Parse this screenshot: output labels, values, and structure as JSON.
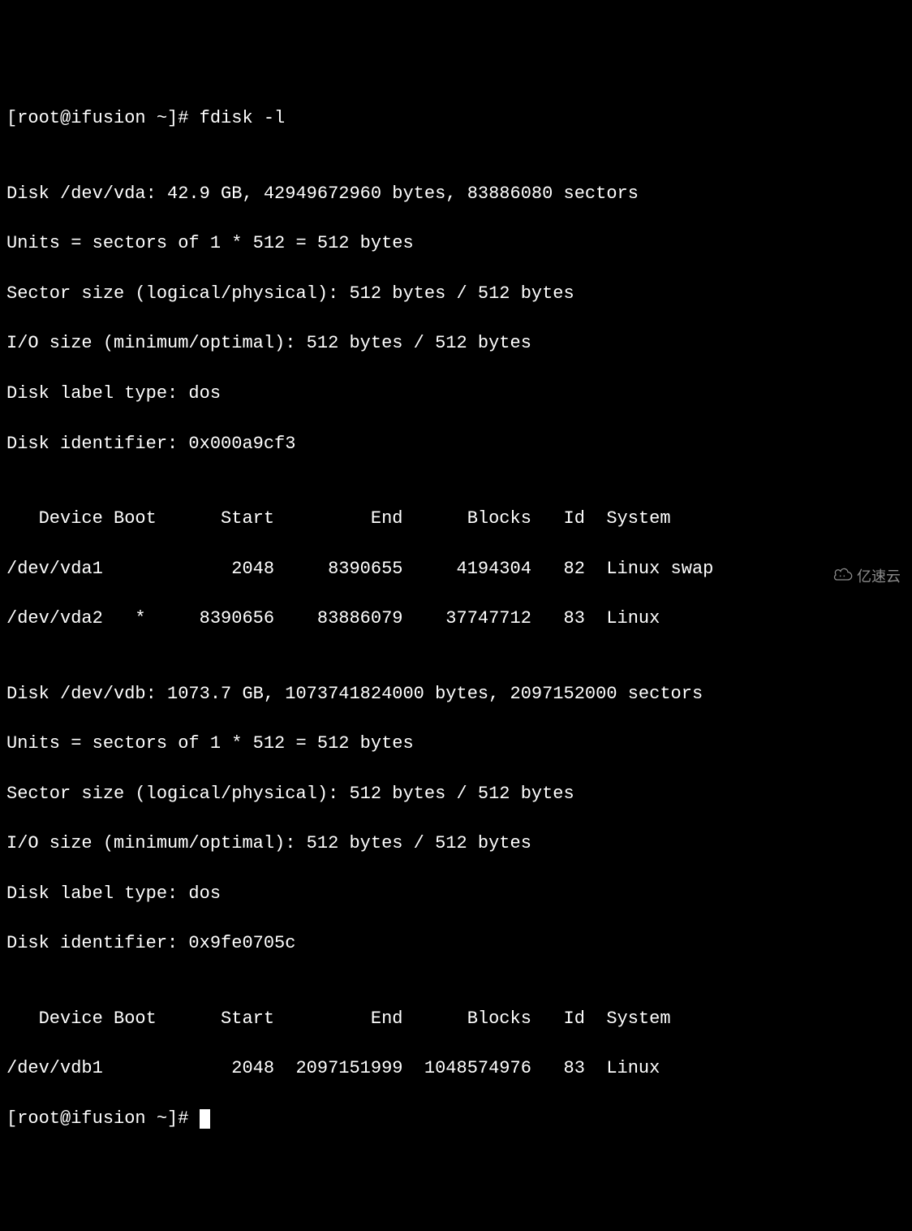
{
  "prompt1": "[root@ifusion ~]# fdisk -l",
  "blank": "",
  "disk1": {
    "header": "Disk /dev/vda: 42.9 GB, 42949672960 bytes, 83886080 sectors",
    "units": "Units = sectors of 1 * 512 = 512 bytes",
    "sector_size": "Sector size (logical/physical): 512 bytes / 512 bytes",
    "io_size": "I/O size (minimum/optimal): 512 bytes / 512 bytes",
    "label_type": "Disk label type: dos",
    "identifier": "Disk identifier: 0x000a9cf3",
    "table_header": "   Device Boot      Start         End      Blocks   Id  System",
    "row1": "/dev/vda1            2048     8390655     4194304   82  Linux swap",
    "row2": "/dev/vda2   *     8390656    83886079    37747712   83  Linux"
  },
  "disk2": {
    "header": "Disk /dev/vdb: 1073.7 GB, 1073741824000 bytes, 2097152000 sectors",
    "units": "Units = sectors of 1 * 512 = 512 bytes",
    "sector_size": "Sector size (logical/physical): 512 bytes / 512 bytes",
    "io_size": "I/O size (minimum/optimal): 512 bytes / 512 bytes",
    "label_type": "Disk label type: dos",
    "identifier": "Disk identifier: 0x9fe0705c",
    "table_header": "   Device Boot      Start         End      Blocks   Id  System",
    "row1": "/dev/vdb1            2048  2097151999  1048574976   83  Linux"
  },
  "prompt2": "[root@ifusion ~]# ",
  "watermark_text": "亿速云"
}
